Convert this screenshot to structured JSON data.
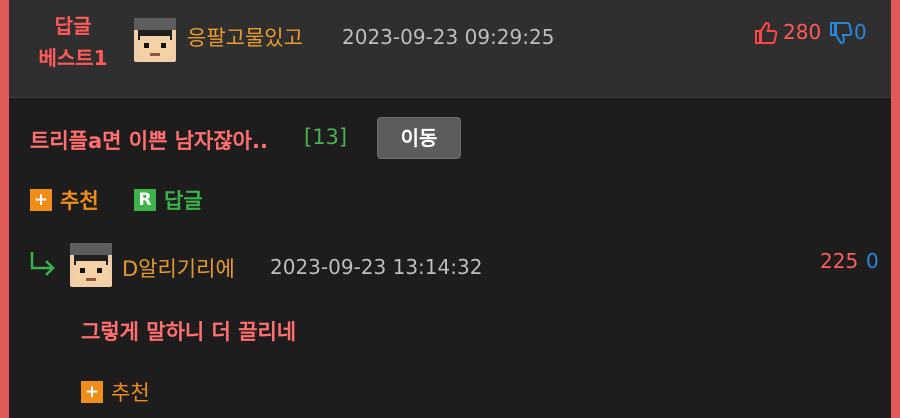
{
  "best_comment": {
    "badge_line1": "답글",
    "badge_line2": "베스트1",
    "nickname": "응팔고물있고",
    "datetime": "2023-09-23 09:29:25",
    "upvotes": "280",
    "downvotes": "0"
  },
  "post": {
    "title": "트리플a면 이쁜 남자잖아..",
    "comment_count": "[13]",
    "move_button_label": "이동",
    "recommend_label": "추천",
    "reply_label": "답글"
  },
  "reply": {
    "nickname": "D알리기리에",
    "datetime": "2023-09-23 13:14:32",
    "upvotes": "225",
    "downvotes": "0",
    "body": "그렇게 말하니 더 끌리네",
    "recommend_label": "추천"
  },
  "colors": {
    "accent_red": "#ff5a5a",
    "nickname_orange": "#e89a2f",
    "reply_green": "#3cb34a",
    "down_blue": "#2a86d9"
  }
}
